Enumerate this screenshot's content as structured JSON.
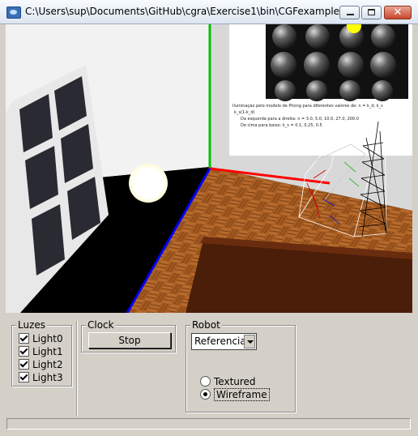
{
  "window": {
    "title": "C:\\Users\\sup\\Documents\\GitHub\\cgra\\Exercise1\\bin\\CGFexample.exe",
    "icon": "app-window-icon",
    "controls": [
      "minimize-icon",
      "maximize-icon",
      "close-icon"
    ]
  },
  "scene": {
    "poster_text_lines": [
      "Iluminação pelo modelo de Phong para diferentes valores de: n = k_d, k_s",
      "k_s(1-k_d)",
      "Da esquerda para a direita: n = 3.0, 5.0, 10.0, 27.0, 200.0",
      "De cima para baixo: k_s = 0.1, 0.25, 0.5"
    ],
    "colors": {
      "axis_x": "#ff0000",
      "axis_y": "#00c000",
      "axis_z": "#0000ff",
      "light": "#ffff00"
    }
  },
  "panel": {
    "luzes": {
      "title": "Luzes",
      "items": [
        {
          "label": "Light0",
          "checked": true
        },
        {
          "label": "Light1",
          "checked": true
        },
        {
          "label": "Light2",
          "checked": true
        },
        {
          "label": "Light3",
          "checked": true
        }
      ]
    },
    "clock": {
      "title": "Clock",
      "button": "Stop"
    },
    "robot": {
      "title": "Robot",
      "select_value": "Referencia",
      "options": [
        {
          "label": "Textured",
          "selected": false
        },
        {
          "label": "Wireframe",
          "selected": true
        }
      ]
    }
  }
}
